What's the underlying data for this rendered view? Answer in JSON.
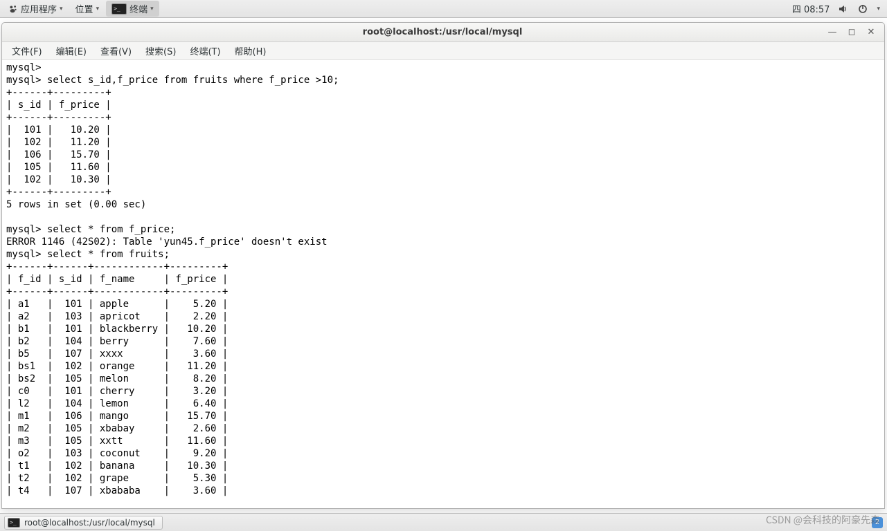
{
  "panel": {
    "apps": "应用程序",
    "places": "位置",
    "active_app": "终端",
    "clock": "四 08:57"
  },
  "window": {
    "title": "root@localhost:/usr/local/mysql"
  },
  "menubar": {
    "file": "文件(F)",
    "edit": "编辑(E)",
    "view": "查看(V)",
    "search": "搜索(S)",
    "terminal": "终端(T)",
    "help": "帮助(H)"
  },
  "taskbar": {
    "task1": "root@localhost:/usr/local/mysql",
    "ws": "2"
  },
  "watermark": "CSDN @会科技的阿豪先森",
  "terminal": {
    "prompt": "mysql>",
    "q1": "select s_id,f_price from fruits where f_price >10;",
    "q2": "select * from f_price;",
    "error": "ERROR 1146 (42S02): Table 'yun45.f_price' doesn't exist",
    "q3": "select * from fruits;",
    "rows_msg": "5 rows in set (0.00 sec)",
    "t1": {
      "headers": [
        "s_id",
        "f_price"
      ],
      "rows": [
        [
          "101",
          "10.20"
        ],
        [
          "102",
          "11.20"
        ],
        [
          "106",
          "15.70"
        ],
        [
          "105",
          "11.60"
        ],
        [
          "102",
          "10.30"
        ]
      ]
    },
    "t2": {
      "headers": [
        "f_id",
        "s_id",
        "f_name",
        "f_price"
      ],
      "rows": [
        [
          "a1",
          "101",
          "apple",
          "5.20"
        ],
        [
          "a2",
          "103",
          "apricot",
          "2.20"
        ],
        [
          "b1",
          "101",
          "blackberry",
          "10.20"
        ],
        [
          "b2",
          "104",
          "berry",
          "7.60"
        ],
        [
          "b5",
          "107",
          "xxxx",
          "3.60"
        ],
        [
          "bs1",
          "102",
          "orange",
          "11.20"
        ],
        [
          "bs2",
          "105",
          "melon",
          "8.20"
        ],
        [
          "c0",
          "101",
          "cherry",
          "3.20"
        ],
        [
          "l2",
          "104",
          "lemon",
          "6.40"
        ],
        [
          "m1",
          "106",
          "mango",
          "15.70"
        ],
        [
          "m2",
          "105",
          "xbabay",
          "2.60"
        ],
        [
          "m3",
          "105",
          "xxtt",
          "11.60"
        ],
        [
          "o2",
          "103",
          "coconut",
          "9.20"
        ],
        [
          "t1",
          "102",
          "banana",
          "10.30"
        ],
        [
          "t2",
          "102",
          "grape",
          "5.30"
        ],
        [
          "t4",
          "107",
          "xbababa",
          "3.60"
        ]
      ]
    }
  }
}
